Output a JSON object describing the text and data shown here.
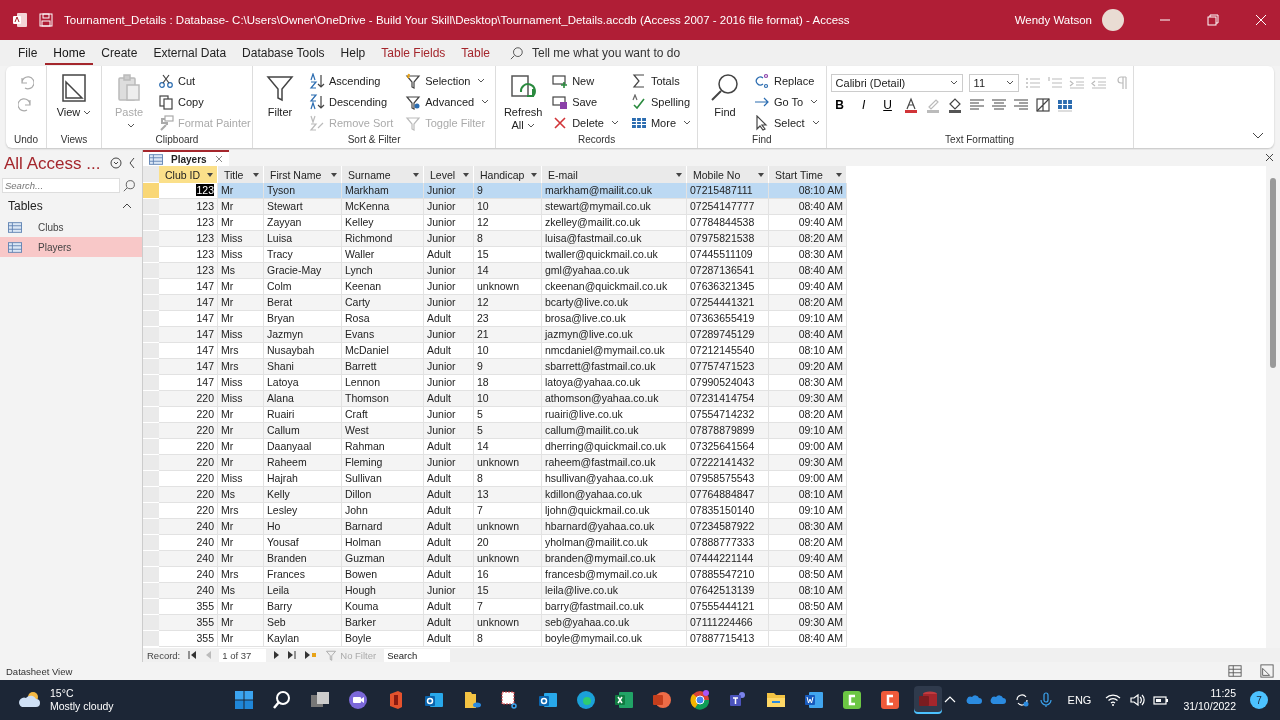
{
  "window": {
    "title": "Tournament_Details : Database- C:\\Users\\Owner\\OneDrive - Build Your Skill\\Desktop\\Tournament_Details.accdb (Access 2007 - 2016 file format)  -  Access",
    "user": "Wendy Watson"
  },
  "menu_tabs": [
    {
      "label": "File",
      "selected": false,
      "contextual": false
    },
    {
      "label": "Home",
      "selected": true,
      "contextual": false
    },
    {
      "label": "Create",
      "selected": false,
      "contextual": false
    },
    {
      "label": "External Data",
      "selected": false,
      "contextual": false
    },
    {
      "label": "Database Tools",
      "selected": false,
      "contextual": false
    },
    {
      "label": "Help",
      "selected": false,
      "contextual": false
    },
    {
      "label": "Table Fields",
      "selected": false,
      "contextual": true
    },
    {
      "label": "Table",
      "selected": false,
      "contextual": true
    }
  ],
  "tell_me": {
    "placeholder": "Tell me what you want to do"
  },
  "ribbon": {
    "groups": [
      {
        "label": "Undo"
      },
      {
        "label": "Views",
        "large": [
          {
            "label": "View",
            "disabled": false,
            "dropdown": true
          }
        ]
      },
      {
        "label": "Clipboard",
        "large": [
          {
            "label": "Paste",
            "disabled": true,
            "dropdown": true
          }
        ],
        "small": [
          {
            "label": "Cut",
            "disabled": false,
            "dropdown": false
          },
          {
            "label": "Copy",
            "disabled": false,
            "dropdown": false
          },
          {
            "label": "Format Painter",
            "disabled": true,
            "dropdown": false
          }
        ]
      },
      {
        "label": "Sort & Filter",
        "large": [
          {
            "label": "Filter",
            "disabled": false,
            "dropdown": false
          }
        ],
        "small": [
          {
            "label": "Ascending",
            "disabled": false,
            "dropdown": false
          },
          {
            "label": "Descending",
            "disabled": false,
            "dropdown": false
          },
          {
            "label": "Remove Sort",
            "disabled": true,
            "dropdown": false
          },
          {
            "label": "Selection",
            "disabled": false,
            "dropdown": true
          },
          {
            "label": "Advanced",
            "disabled": false,
            "dropdown": true
          },
          {
            "label": "Toggle Filter",
            "disabled": true,
            "dropdown": false
          }
        ]
      },
      {
        "label": "Records",
        "large": [
          {
            "label": "Refresh All",
            "disabled": false,
            "dropdown": true
          }
        ],
        "small": [
          {
            "label": "New",
            "disabled": false,
            "dropdown": false
          },
          {
            "label": "Save",
            "disabled": false,
            "dropdown": false
          },
          {
            "label": "Delete",
            "disabled": false,
            "dropdown": true
          },
          {
            "label": "Totals",
            "disabled": false,
            "dropdown": false
          },
          {
            "label": "Spelling",
            "disabled": false,
            "dropdown": false
          },
          {
            "label": "More",
            "disabled": false,
            "dropdown": true
          }
        ]
      },
      {
        "label": "Find",
        "large": [
          {
            "label": "Find",
            "disabled": false,
            "dropdown": false
          }
        ],
        "small": [
          {
            "label": "Replace",
            "disabled": false,
            "dropdown": false
          },
          {
            "label": "Go To",
            "disabled": false,
            "dropdown": true
          },
          {
            "label": "Select",
            "disabled": false,
            "dropdown": true
          }
        ]
      },
      {
        "label": "Text Formatting",
        "font": "Calibri (Detail)",
        "size": "11",
        "format_buttons": [
          "B",
          "I",
          "U"
        ]
      }
    ]
  },
  "nav_pane": {
    "title": "All Access ...",
    "search": {
      "placeholder": "Search..."
    },
    "group": "Tables",
    "items": [
      {
        "label": "Clubs",
        "selected": false
      },
      {
        "label": "Players",
        "selected": true
      }
    ]
  },
  "document_tab": {
    "label": "Players"
  },
  "table": {
    "columns": [
      {
        "label": "Club ID",
        "selected": true
      },
      {
        "label": "Title",
        "selected": false
      },
      {
        "label": "First Name",
        "selected": false
      },
      {
        "label": "Surname",
        "selected": false
      },
      {
        "label": "Level",
        "selected": false
      },
      {
        "label": "Handicap",
        "selected": false
      },
      {
        "label": "E-mail",
        "selected": false
      },
      {
        "label": "Mobile No",
        "selected": false
      },
      {
        "label": "Start Time",
        "selected": false
      }
    ],
    "rows": [
      {
        "selected": true,
        "cells": [
          "123",
          "Mr",
          "Tyson",
          "Markham",
          "Junior",
          "9",
          "markham@mailit.co.uk",
          "07215487111",
          "08:10 AM"
        ]
      },
      {
        "selected": false,
        "cells": [
          "123",
          "Mr",
          "Stewart",
          "McKenna",
          "Junior",
          "10",
          "stewart@mymail.co.uk",
          "07254147777",
          "08:40 AM"
        ]
      },
      {
        "selected": false,
        "cells": [
          "123",
          "Mr",
          "Zayyan",
          "Kelley",
          "Junior",
          "12",
          "zkelley@mailit.co.uk",
          "07784844538",
          "09:40 AM"
        ]
      },
      {
        "selected": false,
        "cells": [
          "123",
          "Miss",
          "Luisa",
          "Richmond",
          "Junior",
          "8",
          "luisa@fastmail.co.uk",
          "07975821538",
          "08:20 AM"
        ]
      },
      {
        "selected": false,
        "cells": [
          "123",
          "Miss",
          "Tracy",
          "Waller",
          "Adult",
          "15",
          "twaller@quickmail.co.uk",
          "07445511109",
          "08:30 AM"
        ]
      },
      {
        "selected": false,
        "cells": [
          "123",
          "Ms",
          "Gracie-May",
          "Lynch",
          "Junior",
          "14",
          "gml@yahaa.co.uk",
          "07287136541",
          "08:40 AM"
        ]
      },
      {
        "selected": false,
        "cells": [
          "147",
          "Mr",
          "Colm",
          "Keenan",
          "Junior",
          "unknown",
          "ckeenan@quickmail.co.uk",
          "07636321345",
          "09:40 AM"
        ]
      },
      {
        "selected": false,
        "cells": [
          "147",
          "Mr",
          "Berat",
          "Carty",
          "Junior",
          "12",
          "bcarty@live.co.uk",
          "07254441321",
          "08:20 AM"
        ]
      },
      {
        "selected": false,
        "cells": [
          "147",
          "Mr",
          "Bryan",
          "Rosa",
          "Adult",
          "23",
          "brosa@live.co.uk",
          "07363655419",
          "09:10 AM"
        ]
      },
      {
        "selected": false,
        "cells": [
          "147",
          "Miss",
          "Jazmyn",
          "Evans",
          "Junior",
          "21",
          "jazmyn@live.co.uk",
          "07289745129",
          "08:40 AM"
        ]
      },
      {
        "selected": false,
        "cells": [
          "147",
          "Mrs",
          "Nusaybah",
          "McDaniel",
          "Adult",
          "10",
          "nmcdaniel@mymail.co.uk",
          "07212145540",
          "08:10 AM"
        ]
      },
      {
        "selected": false,
        "cells": [
          "147",
          "Mrs",
          "Shani",
          "Barrett",
          "Junior",
          "9",
          "sbarrett@fastmail.co.uk",
          "07757471523",
          "09:20 AM"
        ]
      },
      {
        "selected": false,
        "cells": [
          "147",
          "Miss",
          "Latoya",
          "Lennon",
          "Junior",
          "18",
          "latoya@yahaa.co.uk",
          "07990524043",
          "08:30 AM"
        ]
      },
      {
        "selected": false,
        "cells": [
          "220",
          "Miss",
          "Alana",
          "Thomson",
          "Adult",
          "10",
          "athomson@yahaa.co.uk",
          "07231414754",
          "09:30 AM"
        ]
      },
      {
        "selected": false,
        "cells": [
          "220",
          "Mr",
          "Ruairi",
          "Craft",
          "Junior",
          "5",
          "ruairi@live.co.uk",
          "07554714232",
          "08:20 AM"
        ]
      },
      {
        "selected": false,
        "cells": [
          "220",
          "Mr",
          "Callum",
          "West",
          "Junior",
          "5",
          "callum@mailit.co.uk",
          "07878879899",
          "09:10 AM"
        ]
      },
      {
        "selected": false,
        "cells": [
          "220",
          "Mr",
          "Daanyaal",
          "Rahman",
          "Adult",
          "14",
          "dherring@quickmail.co.uk",
          "07325641564",
          "09:00 AM"
        ]
      },
      {
        "selected": false,
        "cells": [
          "220",
          "Mr",
          "Raheem",
          "Fleming",
          "Junior",
          "unknown",
          "raheem@fastmail.co.uk",
          "07222141432",
          "09:30 AM"
        ]
      },
      {
        "selected": false,
        "cells": [
          "220",
          "Miss",
          "Hajrah",
          "Sullivan",
          "Adult",
          "8",
          "hsullivan@yahaa.co.uk",
          "07958575543",
          "09:00 AM"
        ]
      },
      {
        "selected": false,
        "cells": [
          "220",
          "Ms",
          "Kelly",
          "Dillon",
          "Adult",
          "13",
          "kdillon@yahaa.co.uk",
          "07764884847",
          "08:10 AM"
        ]
      },
      {
        "selected": false,
        "cells": [
          "220",
          "Mrs",
          "Lesley",
          "John",
          "Adult",
          "7",
          "ljohn@quickmail.co.uk",
          "07835150140",
          "09:10 AM"
        ]
      },
      {
        "selected": false,
        "cells": [
          "240",
          "Mr",
          "Ho",
          "Barnard",
          "Adult",
          "unknown",
          "hbarnard@yahaa.co.uk",
          "07234587922",
          "08:30 AM"
        ]
      },
      {
        "selected": false,
        "cells": [
          "240",
          "Mr",
          "Yousaf",
          "Holman",
          "Adult",
          "20",
          "yholman@mailit.co.uk",
          "07888777333",
          "08:20 AM"
        ]
      },
      {
        "selected": false,
        "cells": [
          "240",
          "Mr",
          "Branden",
          "Guzman",
          "Adult",
          "unknown",
          "branden@mymail.co.uk",
          "07444221144",
          "09:40 AM"
        ]
      },
      {
        "selected": false,
        "cells": [
          "240",
          "Mrs",
          "Frances",
          "Bowen",
          "Adult",
          "16",
          "francesb@mymail.co.uk",
          "07885547210",
          "08:50 AM"
        ]
      },
      {
        "selected": false,
        "cells": [
          "240",
          "Ms",
          "Leila",
          "Hough",
          "Junior",
          "15",
          "leila@live.co.uk",
          "07642513139",
          "08:10 AM"
        ]
      },
      {
        "selected": false,
        "cells": [
          "355",
          "Mr",
          "Barry",
          "Kouma",
          "Adult",
          "7",
          "barry@fastmail.co.uk",
          "07555444121",
          "08:50 AM"
        ]
      },
      {
        "selected": false,
        "cells": [
          "355",
          "Mr",
          "Seb",
          "Barker",
          "Adult",
          "unknown",
          "seb@yahaa.co.uk",
          "07111224466",
          "09:30 AM"
        ]
      },
      {
        "selected": false,
        "cells": [
          "355",
          "Mr",
          "Kaylan",
          "Boyle",
          "Adult",
          "8",
          "boyle@mymail.co.uk",
          "07887715413",
          "08:40 AM"
        ]
      }
    ]
  },
  "record_nav": {
    "label": "Record:",
    "position": "1 of 37",
    "filter": "No Filter",
    "filter_disabled": true,
    "search": {
      "placeholder": "Search"
    }
  },
  "status_bar": {
    "text": "Datasheet View"
  },
  "taskbar": {
    "weather": {
      "temp": "15°C",
      "text": "Mostly cloudy"
    },
    "language": "ENG",
    "time": "11:25",
    "date": "31/10/2022",
    "notifications": "7"
  }
}
